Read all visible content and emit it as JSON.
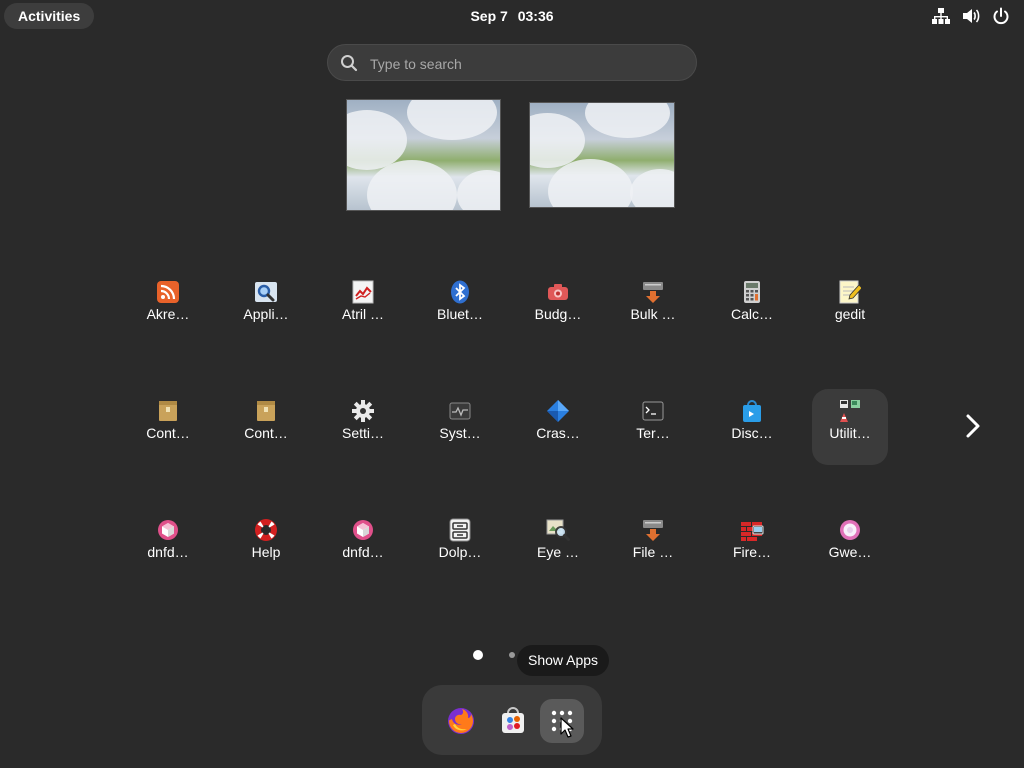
{
  "topbar": {
    "activities_label": "Activities",
    "date": "Sep 7",
    "time": "03:36",
    "tray_icons": [
      "network-wired-icon",
      "volume-icon",
      "power-icon"
    ]
  },
  "search": {
    "placeholder": "Type to search"
  },
  "apps": [
    {
      "label": "Akre…",
      "icon": "rss-icon"
    },
    {
      "label": "Appli…",
      "icon": "magnifier-icon"
    },
    {
      "label": "Atril …",
      "icon": "document-viewer-icon"
    },
    {
      "label": "Bluet…",
      "icon": "bluetooth-icon"
    },
    {
      "label": "Budg…",
      "icon": "camera-icon"
    },
    {
      "label": "Bulk …",
      "icon": "rename-icon"
    },
    {
      "label": "Calc…",
      "icon": "calculator-icon"
    },
    {
      "label": "gedit",
      "icon": "text-editor-icon"
    },
    {
      "label": "Cont…",
      "icon": "package-icon"
    },
    {
      "label": "Cont…",
      "icon": "package-icon"
    },
    {
      "label": "Setti…",
      "icon": "gear-icon"
    },
    {
      "label": "Syst…",
      "icon": "system-monitor-icon"
    },
    {
      "label": "Cras…",
      "icon": "diamond-icon"
    },
    {
      "label": "Ter…",
      "icon": "terminal-icon"
    },
    {
      "label": "Disc…",
      "icon": "software-store-icon"
    },
    {
      "label": "Utilit…",
      "icon": "utilities-folder-icon"
    },
    {
      "label": "dnfd…",
      "icon": "cube-icon"
    },
    {
      "label": "Help",
      "icon": "lifebuoy-icon"
    },
    {
      "label": "dnfd…",
      "icon": "cube-icon"
    },
    {
      "label": "Dolp…",
      "icon": "file-manager-icon"
    },
    {
      "label": "Eye …",
      "icon": "image-viewer-icon"
    },
    {
      "label": "File …",
      "icon": "rename-icon"
    },
    {
      "label": "Fire…",
      "icon": "firewall-icon"
    },
    {
      "label": "Gwe…",
      "icon": "web-browser-icon"
    }
  ],
  "tooltip": "Show Apps",
  "dock": [
    "firefox-icon",
    "software-icon",
    "show-apps-icon"
  ],
  "pagination": {
    "pages": 2,
    "current": 1
  }
}
